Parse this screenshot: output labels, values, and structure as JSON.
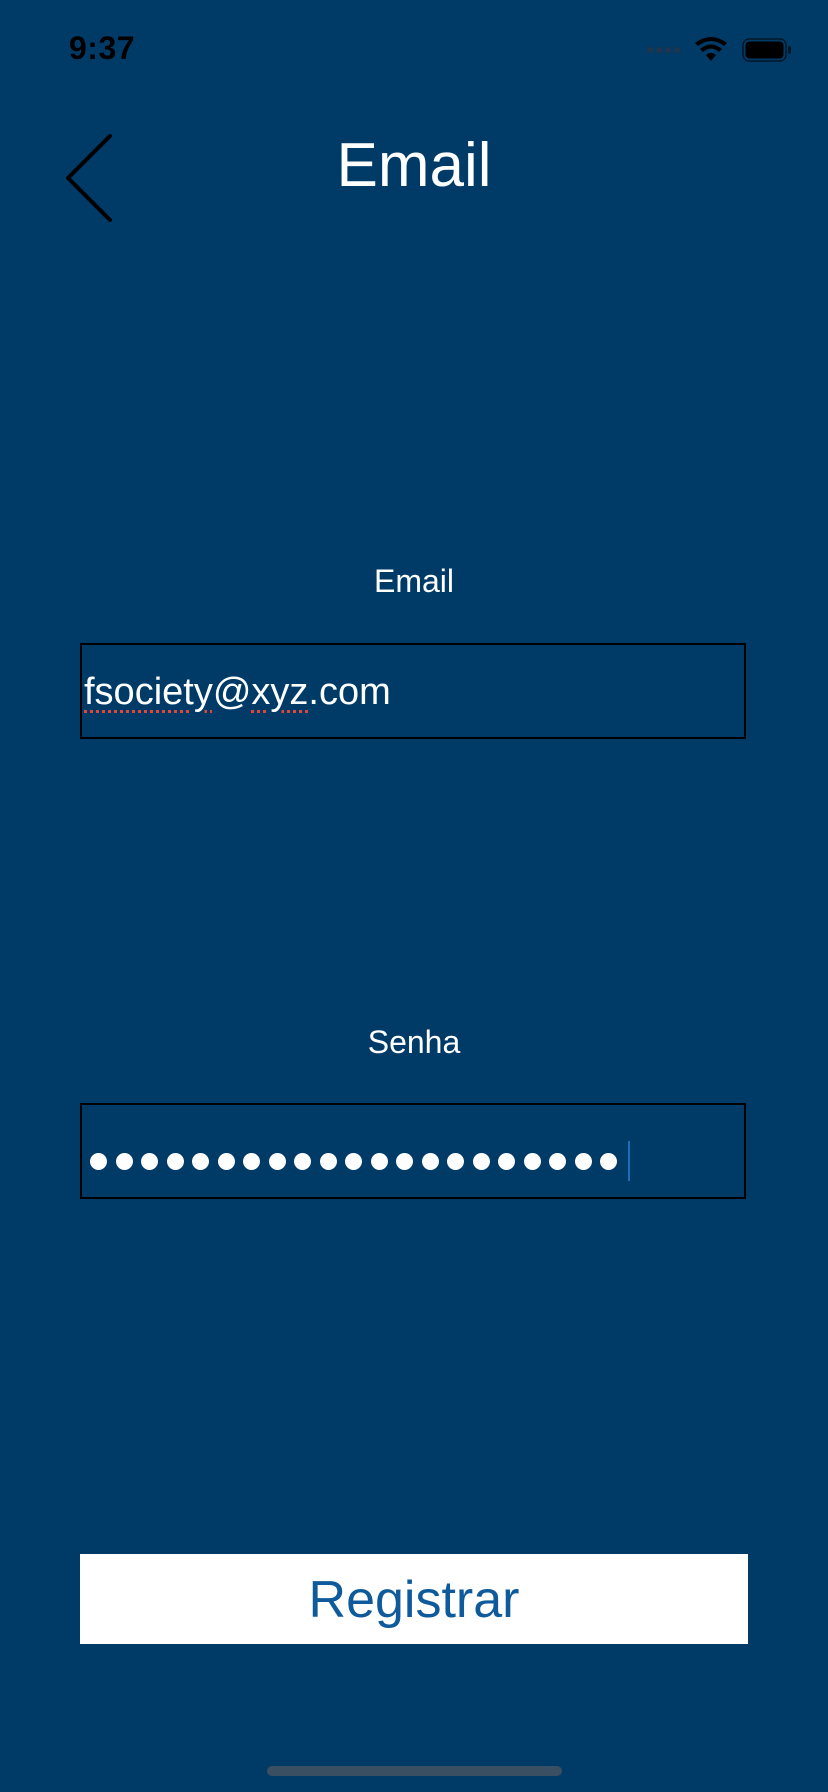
{
  "status_bar": {
    "time": "9:37",
    "icons": [
      "cellular-signal-icon",
      "wifi-icon",
      "battery-icon"
    ]
  },
  "nav": {
    "back_icon": "chevron-left-icon",
    "title": "Email"
  },
  "form": {
    "email": {
      "label": "Email",
      "value_part1": "fsociety",
      "value_at": "@",
      "value_part2": "xyz",
      "value_part3": ".com"
    },
    "password": {
      "label": "Senha",
      "masked_char_count": 21
    }
  },
  "actions": {
    "register_label": "Registrar"
  },
  "colors": {
    "background": "#003a66",
    "button_background": "#ffffff",
    "button_text": "#0e5a9a",
    "spellcheck_underline": "#e0463c"
  }
}
